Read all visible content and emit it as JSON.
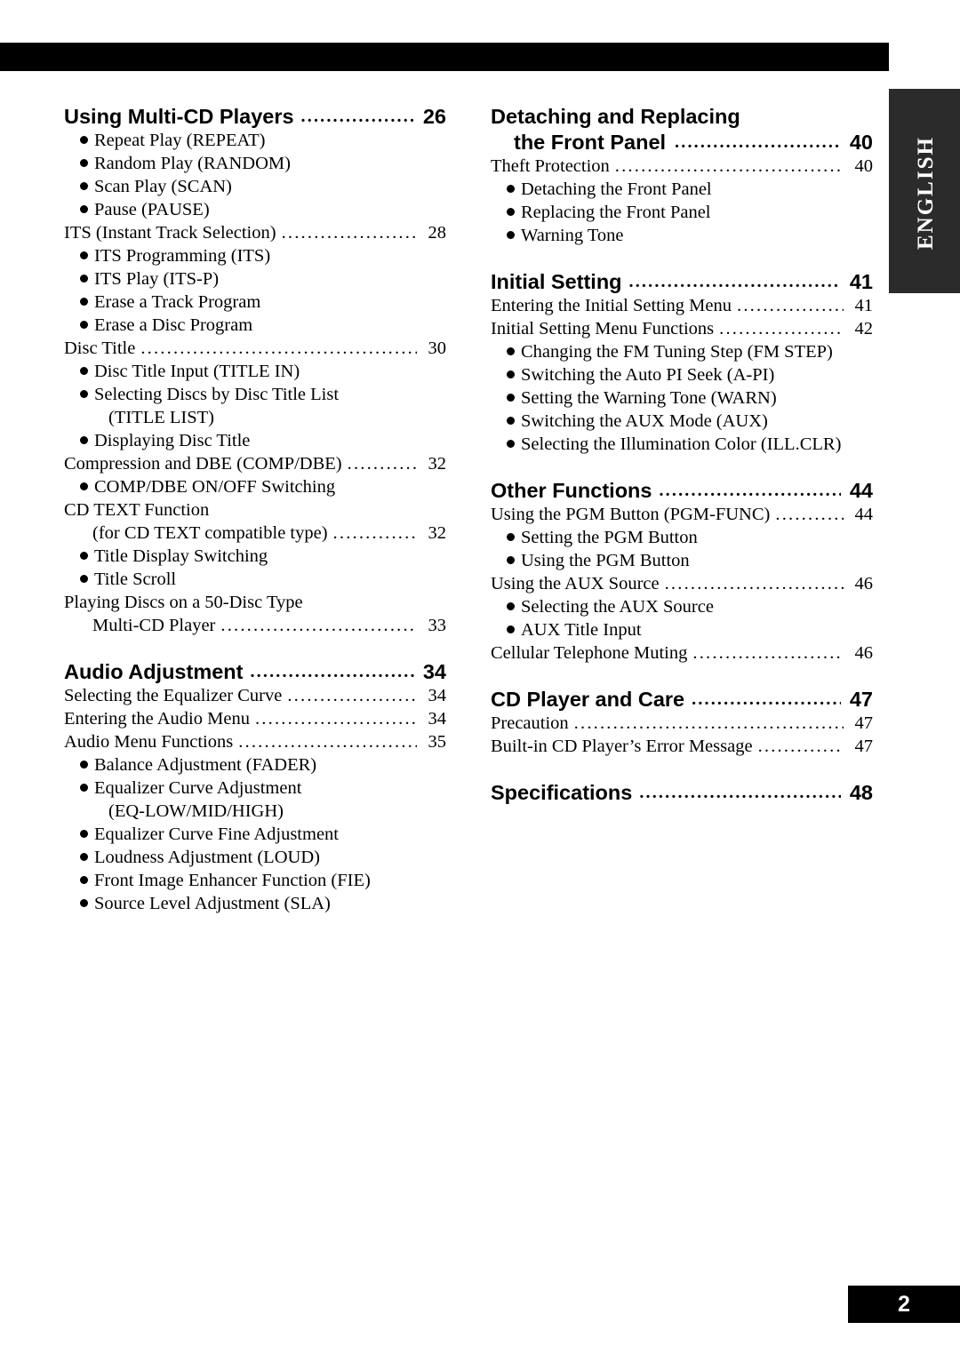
{
  "document": {
    "page_number": "2",
    "language_tab": "ENGLISH"
  },
  "left_column": {
    "sections": [
      {
        "type": "heading",
        "title": "Using Multi-CD Players",
        "page": "26"
      },
      {
        "type": "bullet",
        "level": 1,
        "text": "Repeat Play (REPEAT)"
      },
      {
        "type": "bullet",
        "level": 1,
        "text": "Random Play (RANDOM)"
      },
      {
        "type": "bullet",
        "level": 1,
        "text": "Scan Play (SCAN)"
      },
      {
        "type": "bullet",
        "level": 1,
        "text": "Pause (PAUSE)"
      },
      {
        "type": "entry",
        "level": 0,
        "text": "ITS (Instant Track Selection)",
        "page": "28"
      },
      {
        "type": "bullet",
        "level": 1,
        "text": "ITS Programming (ITS)"
      },
      {
        "type": "bullet",
        "level": 1,
        "text": "ITS Play (ITS-P)"
      },
      {
        "type": "bullet",
        "level": 1,
        "text": "Erase a Track Program"
      },
      {
        "type": "bullet",
        "level": 1,
        "text": "Erase a Disc Program"
      },
      {
        "type": "entry",
        "level": 0,
        "text": "Disc Title",
        "page": "30"
      },
      {
        "type": "bullet",
        "level": 1,
        "text": "Disc Title Input (TITLE IN)"
      },
      {
        "type": "bullet",
        "level": 1,
        "text": "Selecting Discs by Disc Title List"
      },
      {
        "type": "plain",
        "level": "1-cont",
        "text": "(TITLE LIST)"
      },
      {
        "type": "bullet",
        "level": 1,
        "text": "Displaying Disc Title"
      },
      {
        "type": "entry",
        "level": 0,
        "text": "Compression and DBE (COMP/DBE)",
        "page": "32"
      },
      {
        "type": "bullet",
        "level": 1,
        "text": "COMP/DBE ON/OFF Switching"
      },
      {
        "type": "plain",
        "level": 0,
        "text": "CD TEXT Function"
      },
      {
        "type": "entry",
        "level": "0-cont",
        "text": "(for CD TEXT compatible type)",
        "page": "32"
      },
      {
        "type": "bullet",
        "level": 1,
        "text": "Title Display Switching"
      },
      {
        "type": "bullet",
        "level": 1,
        "text": "Title Scroll"
      },
      {
        "type": "plain",
        "level": 0,
        "text": "Playing Discs on a 50-Disc Type"
      },
      {
        "type": "entry",
        "level": "0-cont",
        "text": "Multi-CD Player",
        "page": "33"
      },
      {
        "type": "heading",
        "title": "Audio Adjustment",
        "page": "34"
      },
      {
        "type": "entry",
        "level": 0,
        "text": "Selecting the Equalizer Curve",
        "page": "34"
      },
      {
        "type": "entry",
        "level": 0,
        "text": "Entering the Audio Menu",
        "page": "34"
      },
      {
        "type": "entry",
        "level": 0,
        "text": "Audio Menu Functions",
        "page": "35"
      },
      {
        "type": "bullet",
        "level": 1,
        "text": "Balance Adjustment (FADER)"
      },
      {
        "type": "bullet",
        "level": 1,
        "text": "Equalizer Curve Adjustment"
      },
      {
        "type": "plain",
        "level": "1-cont",
        "text": "(EQ-LOW/MID/HIGH)"
      },
      {
        "type": "bullet",
        "level": 1,
        "text": "Equalizer Curve Fine Adjustment"
      },
      {
        "type": "bullet",
        "level": 1,
        "text": "Loudness Adjustment (LOUD)"
      },
      {
        "type": "bullet",
        "level": 1,
        "text": "Front Image Enhancer Function (FIE)"
      },
      {
        "type": "bullet",
        "level": 1,
        "text": "Source Level Adjustment (SLA)"
      }
    ]
  },
  "right_column": {
    "sections": [
      {
        "type": "heading-nodots",
        "title": "Detaching and Replacing"
      },
      {
        "type": "heading-cont",
        "title": "the Front Panel",
        "page": "40"
      },
      {
        "type": "entry",
        "level": 0,
        "text": "Theft Protection",
        "page": "40"
      },
      {
        "type": "bullet",
        "level": 1,
        "text": "Detaching the Front Panel"
      },
      {
        "type": "bullet",
        "level": 1,
        "text": "Replacing the Front Panel"
      },
      {
        "type": "bullet",
        "level": 1,
        "text": "Warning Tone"
      },
      {
        "type": "heading",
        "title": "Initial Setting",
        "page": "41"
      },
      {
        "type": "entry",
        "level": 0,
        "text": "Entering the Initial Setting Menu",
        "page": "41"
      },
      {
        "type": "entry",
        "level": 0,
        "text": "Initial Setting Menu Functions",
        "page": "42"
      },
      {
        "type": "bullet",
        "level": 1,
        "text": "Changing the FM Tuning Step (FM STEP)"
      },
      {
        "type": "bullet",
        "level": 1,
        "text": "Switching the Auto PI Seek (A-PI)"
      },
      {
        "type": "bullet",
        "level": 1,
        "text": "Setting the Warning Tone (WARN)"
      },
      {
        "type": "bullet",
        "level": 1,
        "text": "Switching the AUX Mode (AUX)"
      },
      {
        "type": "bullet",
        "level": 1,
        "text": "Selecting the Illumination Color (ILL.CLR)"
      },
      {
        "type": "heading",
        "title": "Other Functions",
        "page": "44"
      },
      {
        "type": "entry",
        "level": 0,
        "text": "Using the PGM Button (PGM-FUNC)",
        "page": "44"
      },
      {
        "type": "bullet",
        "level": 1,
        "text": "Setting the PGM Button"
      },
      {
        "type": "bullet",
        "level": 1,
        "text": "Using the PGM Button"
      },
      {
        "type": "entry",
        "level": 0,
        "text": "Using the AUX Source",
        "page": "46"
      },
      {
        "type": "bullet",
        "level": 1,
        "text": "Selecting the AUX Source"
      },
      {
        "type": "bullet",
        "level": 1,
        "text": "AUX Title Input"
      },
      {
        "type": "entry",
        "level": 0,
        "text": "Cellular Telephone Muting",
        "page": "46"
      },
      {
        "type": "heading",
        "title": "CD Player and Care",
        "page": "47"
      },
      {
        "type": "entry",
        "level": 0,
        "text": "Precaution",
        "page": "47"
      },
      {
        "type": "entry",
        "level": 0,
        "text": "Built-in CD Player’s Error Message",
        "page": "47"
      },
      {
        "type": "heading",
        "title": "Specifications",
        "page": "48"
      }
    ]
  }
}
